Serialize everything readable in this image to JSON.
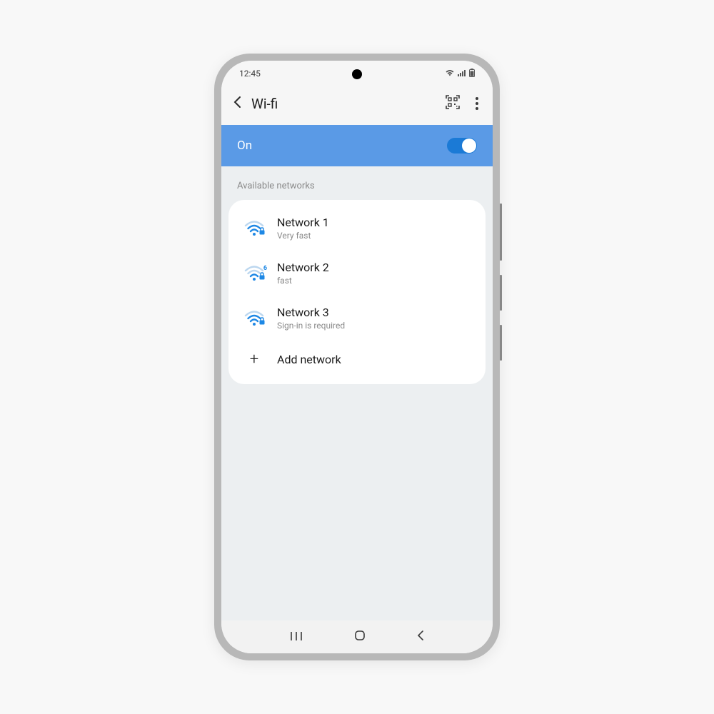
{
  "statusbar": {
    "time": "12:45"
  },
  "header": {
    "title": "Wi-fi"
  },
  "toggle": {
    "label": "On",
    "state": "on"
  },
  "section": {
    "available_label": "Available networks"
  },
  "networks": [
    {
      "name": "Network 1",
      "detail": "Very fast",
      "locked": true,
      "wifi6": false
    },
    {
      "name": "Network 2",
      "detail": "fast",
      "locked": true,
      "wifi6": true
    },
    {
      "name": "Network 3",
      "detail": "Sign-in is required",
      "locked": true,
      "wifi6": false
    }
  ],
  "add_network": {
    "label": "Add network"
  },
  "colors": {
    "accent": "#5a9ae6",
    "toggle_track": "#1b7ad6",
    "wifi_icon": "#1e88e5"
  }
}
